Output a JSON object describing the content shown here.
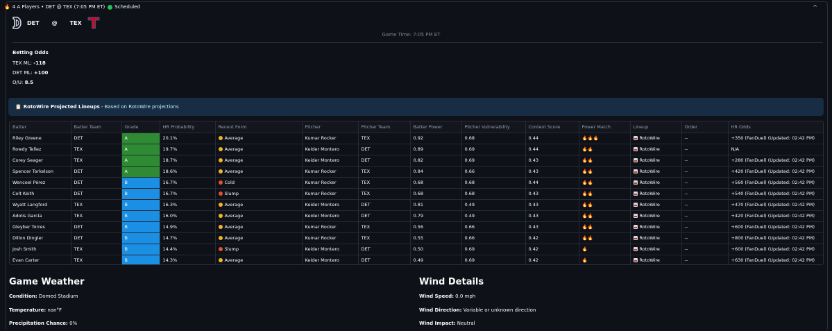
{
  "header": {
    "fire": "🔥",
    "summary": "4 A Players • DET @ TEX (7:05 PM ET)",
    "status": "Scheduled",
    "caret": "^"
  },
  "matchup": {
    "away": "DET",
    "at": "@",
    "home": "TEX",
    "game_time": "Game Time: 7:05 PM ET"
  },
  "odds": {
    "title": "Betting Odds",
    "lines": [
      {
        "label": "TEX ML:",
        "value": "-118"
      },
      {
        "label": "DET ML:",
        "value": "+100"
      },
      {
        "label": "O/U:",
        "value": "8.5"
      }
    ]
  },
  "info": {
    "icon": "📋",
    "title": "RotoWire Projected Lineups",
    "text": "- Based on RotoWire projections"
  },
  "table": {
    "headers": [
      "Batter",
      "Batter Team",
      "Grade",
      "HR Probability",
      "Recent Form",
      "Pitcher",
      "Pitcher Team",
      "Batter Power",
      "Pitcher Vulnerability",
      "Context Score",
      "Power Match",
      "Lineup",
      "Order",
      "HR Odds"
    ],
    "rows": [
      [
        "Riley Greene",
        "DET",
        "A",
        "20.1%",
        "Average",
        "Kumar Rocker",
        "TEX",
        "0.92",
        "0.68",
        "0.44",
        "🔥🔥🔥",
        "RotoWire",
        "--",
        "+350 (FanDuel) (Updated: 02:42 PM)"
      ],
      [
        "Rowdy Tellez",
        "TEX",
        "A",
        "19.7%",
        "Average",
        "Keider Montero",
        "DET",
        "0.89",
        "0.69",
        "0.44",
        "🔥🔥",
        "RotoWire",
        "--",
        "N/A"
      ],
      [
        "Corey Seager",
        "TEX",
        "A",
        "18.7%",
        "Average",
        "Keider Montero",
        "DET",
        "0.82",
        "0.69",
        "0.43",
        "🔥🔥",
        "RotoWire",
        "--",
        "+280 (FanDuel) (Updated: 02:42 PM)"
      ],
      [
        "Spencer Torkelson",
        "DET",
        "A",
        "18.6%",
        "Average",
        "Kumar Rocker",
        "TEX",
        "0.84",
        "0.66",
        "0.43",
        "🔥🔥",
        "RotoWire",
        "--",
        "+420 (FanDuel) (Updated: 02:42 PM)"
      ],
      [
        "Wenceel Pérez",
        "DET",
        "B",
        "16.7%",
        "Cold",
        "Kumar Rocker",
        "TEX",
        "0.68",
        "0.68",
        "0.44",
        "🔥🔥",
        "RotoWire",
        "--",
        "+560 (FanDuel) (Updated: 02:42 PM)"
      ],
      [
        "Colt Keith",
        "DET",
        "B",
        "16.7%",
        "Slump",
        "Kumar Rocker",
        "TEX",
        "0.68",
        "0.68",
        "0.43",
        "🔥🔥",
        "RotoWire",
        "--",
        "+540 (FanDuel) (Updated: 02:42 PM)"
      ],
      [
        "Wyatt Langford",
        "TEX",
        "B",
        "16.3%",
        "Average",
        "Keider Montero",
        "DET",
        "0.81",
        "0.49",
        "0.43",
        "🔥🔥",
        "RotoWire",
        "--",
        "+470 (FanDuel) (Updated: 02:42 PM)"
      ],
      [
        "Adolis García",
        "TEX",
        "B",
        "16.0%",
        "Average",
        "Keider Montero",
        "DET",
        "0.79",
        "0.49",
        "0.43",
        "🔥🔥",
        "RotoWire",
        "--",
        "+420 (FanDuel) (Updated: 02:42 PM)"
      ],
      [
        "Gleyber Torres",
        "DET",
        "B",
        "14.9%",
        "Average",
        "Kumar Rocker",
        "TEX",
        "0.56",
        "0.66",
        "0.43",
        "🔥🔥",
        "RotoWire",
        "--",
        "+600 (FanDuel) (Updated: 02:42 PM)"
      ],
      [
        "Dillon Dingler",
        "DET",
        "B",
        "14.7%",
        "Average",
        "Kumar Rocker",
        "TEX",
        "0.55",
        "0.66",
        "0.42",
        "🔥🔥",
        "RotoWire",
        "--",
        "+800 (FanDuel) (Updated: 02:42 PM)"
      ],
      [
        "Josh Smith",
        "TEX",
        "B",
        "14.4%",
        "Slump",
        "Keider Montero",
        "DET",
        "0.50",
        "0.69",
        "0.42",
        "🔥",
        "RotoWire",
        "--",
        "+600 (FanDuel) (Updated: 02:42 PM)"
      ],
      [
        "Evan Carter",
        "TEX",
        "B",
        "14.3%",
        "Average",
        "Keider Montero",
        "DET",
        "0.49",
        "0.69",
        "0.42",
        "🔥",
        "RotoWire",
        "--",
        "+630 (FanDuel) (Updated: 02:42 PM)"
      ]
    ]
  },
  "form_colors": {
    "Average": "#f0b429",
    "Cold": "#e0532d",
    "Slump": "#e0532d"
  },
  "weather": {
    "title": "Game Weather",
    "condition_label": "Condition:",
    "condition": "Domed Stadium",
    "temperature_label": "Temperature:",
    "temperature": "nan°F",
    "precip_label": "Precipitation Chance:",
    "precip": "0%"
  },
  "wind": {
    "title": "Wind Details",
    "speed_label": "Wind Speed:",
    "speed": "0.0 mph",
    "direction_label": "Wind Direction:",
    "direction": "Variable or unknown direction",
    "impact_label": "Wind Impact:",
    "impact": "Neutral"
  }
}
